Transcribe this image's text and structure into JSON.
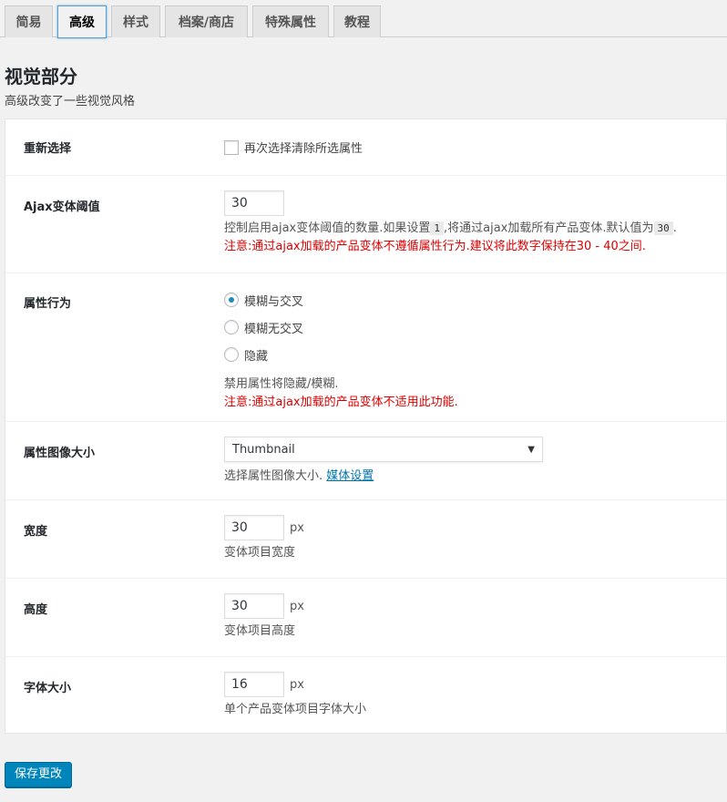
{
  "tabs": [
    {
      "label": "简易"
    },
    {
      "label": "高级"
    },
    {
      "label": "样式"
    },
    {
      "label": "档案/商店"
    },
    {
      "label": "特殊属性"
    },
    {
      "label": "教程"
    }
  ],
  "active_tab": "高级",
  "section": {
    "title": "视觉部分",
    "description": "高级改变了一些视觉风格"
  },
  "settings": {
    "reselect": {
      "label": "重新选择",
      "checkbox_label": "再次选择清除所选属性",
      "checked": false
    },
    "ajax_threshold": {
      "label": "Ajax变体阈值",
      "value": "30",
      "desc_part1": "控制启用ajax变体阈值的数量.如果设置",
      "desc_code1": "1",
      "desc_part2": ",将通过ajax加载所有产品变体.默认值为",
      "desc_code2": "30",
      "desc_part3": ".",
      "warning": "注意:通过ajax加载的产品变体不遵循属性行为.建议将此数字保持在30 - 40之间."
    },
    "attribute_behavior": {
      "label": "属性行为",
      "options": [
        {
          "label": "模糊与交叉",
          "checked": true
        },
        {
          "label": "模糊无交叉",
          "checked": false
        },
        {
          "label": "隐藏",
          "checked": false
        }
      ],
      "description": "禁用属性将隐藏/模糊.",
      "warning": "注意:通过ajax加载的产品变体不适用此功能."
    },
    "image_size": {
      "label": "属性图像大小",
      "selected": "Thumbnail",
      "desc_text": "选择属性图像大小.",
      "link_text": "媒体设置"
    },
    "width": {
      "label": "宽度",
      "value": "30",
      "unit": "px",
      "description": "变体项目宽度"
    },
    "height": {
      "label": "高度",
      "value": "30",
      "unit": "px",
      "description": "变体项目高度"
    },
    "font_size": {
      "label": "字体大小",
      "value": "16",
      "unit": "px",
      "description": "单个产品变体项目字体大小"
    }
  },
  "save_button": "保存更改",
  "colors": {
    "primary": "#0085ba",
    "warning": "#dd0000",
    "link": "#0073aa"
  }
}
